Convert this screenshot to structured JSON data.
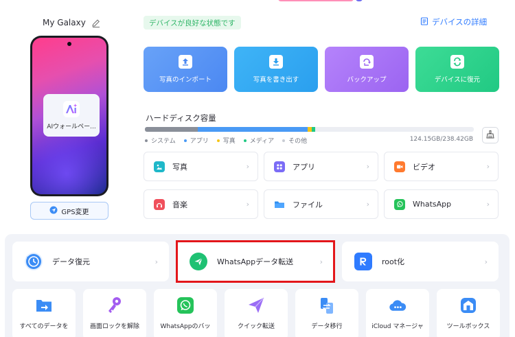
{
  "device": {
    "name": "My Galaxy",
    "wallpaper_card_label": "AIウォールペー...",
    "gps_label": "GPS変更"
  },
  "status": {
    "text": "デバイスが良好な状態です",
    "detail_link": "デバイスの詳細"
  },
  "actions": [
    {
      "label": "写真のインポート",
      "icon": "upload-icon"
    },
    {
      "label": "写真を書き出す",
      "icon": "download-icon"
    },
    {
      "label": "バックアップ",
      "icon": "backup-icon"
    },
    {
      "label": "デバイスに復元",
      "icon": "restore-icon"
    }
  ],
  "disk": {
    "title": "ハードディスク容量",
    "size": "124.15GB/238.42GB",
    "legend": [
      {
        "label": "システム",
        "color": "#8a8f99"
      },
      {
        "label": "アプリ",
        "color": "#4a9af5"
      },
      {
        "label": "写真",
        "color": "#f5c518"
      },
      {
        "label": "メディア",
        "color": "#21c983"
      },
      {
        "label": "その他",
        "color": "#c8ccd4"
      }
    ]
  },
  "categories": [
    {
      "label": "写真",
      "icon": "photo-icon",
      "color": "#1fb8c9"
    },
    {
      "label": "アプリ",
      "icon": "apps-icon",
      "color": "#7b6cf6"
    },
    {
      "label": "ビデオ",
      "icon": "video-icon",
      "color": "#ff7a2f"
    },
    {
      "label": "音楽",
      "icon": "music-icon",
      "color": "#f0505c"
    },
    {
      "label": "ファイル",
      "icon": "folder-icon",
      "color": "#2f8ff0"
    },
    {
      "label": "WhatsApp",
      "icon": "whatsapp-icon",
      "color": "#25c35a"
    }
  ],
  "tools": [
    {
      "label": "データ復元",
      "icon": "data-recovery-icon",
      "color": "#3b8cf5"
    },
    {
      "label": "WhatsAppデータ転送",
      "icon": "whatsapp-transfer-icon",
      "color": "#1fc173"
    },
    {
      "label": "root化",
      "icon": "root-icon",
      "color": "#2f7bff"
    }
  ],
  "small_tools": [
    {
      "label": "すべてのデータを",
      "icon": "transfer-folder-icon",
      "color": "#3b8cf5"
    },
    {
      "label": "画面ロックを解除",
      "icon": "key-icon",
      "color": "#a35cf0"
    },
    {
      "label": "WhatsAppのバッ",
      "icon": "whatsapp-icon",
      "color": "#25c35a"
    },
    {
      "label": "クイック転送",
      "icon": "send-icon",
      "color": "#9a6cf5"
    },
    {
      "label": "データ移行",
      "icon": "migrate-icon",
      "color": "#3b8cf5"
    },
    {
      "label": "iCloud マネージャ",
      "icon": "cloud-icon",
      "color": "#3b8cf5"
    },
    {
      "label": "ツールボックス",
      "icon": "toolbox-icon",
      "color": "#3b8cf5"
    }
  ],
  "colors": {
    "accent": "#2f7bff",
    "highlight": "#e3161b"
  }
}
